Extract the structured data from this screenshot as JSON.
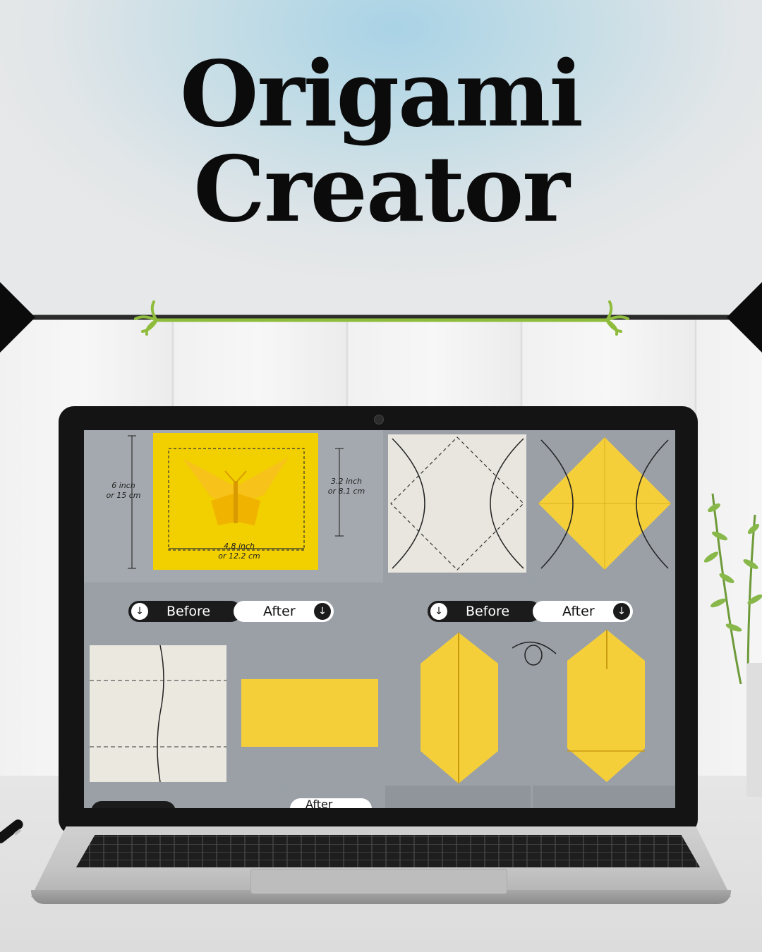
{
  "title": {
    "line1": "Origami",
    "line2": "Creator"
  },
  "screen": {
    "measurements": {
      "height": "6 inch\nor 15 cm",
      "right_height": "3.2 inch\nor 8.1 cm",
      "width": "4.8 inch\nor 12.2 cm"
    },
    "step_pair_left": {
      "before_label": "Before",
      "after_label": "After"
    },
    "step_pair_right": {
      "before_label": "Before",
      "after_label": "After"
    },
    "bottom_row": {
      "partial_after_label": "After"
    }
  },
  "colors": {
    "paper_yellow": "#f2d000",
    "fold_yellow": "#f5cf3a",
    "panel_gray": "#9aa0a6",
    "divider_green": "#8fbc3c"
  }
}
